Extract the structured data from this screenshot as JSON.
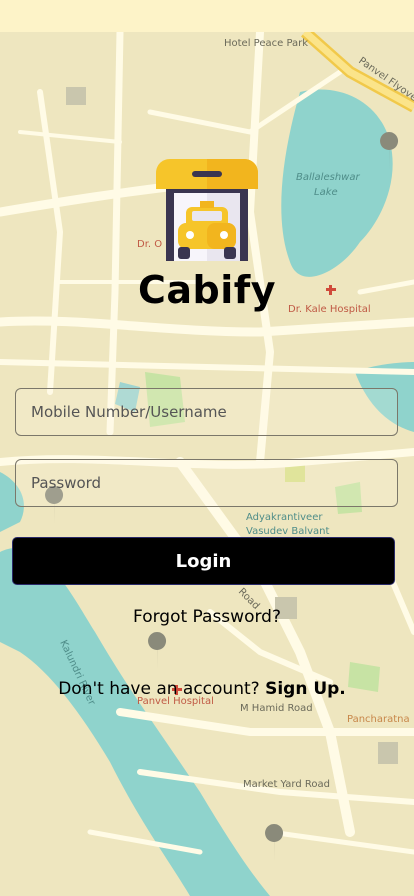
{
  "app": {
    "name": "Cabify"
  },
  "form": {
    "username_placeholder": "Mobile Number/Username",
    "password_placeholder": "Password",
    "login_label": "Login",
    "forgot_label": "Forgot Password?"
  },
  "signup": {
    "prompt": "Don't have an account?",
    "link_label": "Sign Up."
  },
  "map_labels": {
    "hotel": "Hotel Peace Park",
    "flyover": "Panvel Flyover",
    "lake": "Ballaleshwar",
    "lake2": "Lake",
    "hospital1": "Dr. Kale Hospital",
    "dr": "Dr. O",
    "adya": "Adyakrantiveer",
    "vasudev": "Vasudev Balvant",
    "panvel_hospital": "Panvel Hospital",
    "m_hamid": "M Hamid Road",
    "pancharatna": "Pancharatna",
    "market_yard": "Market Yard Road",
    "river": "Kalundri River",
    "road": "Road"
  },
  "colors": {
    "map_bg": "#eee6bf",
    "road": "#fffbe6",
    "water": "#8fd3cc",
    "park": "#c7e3a4",
    "button_bg": "#000000"
  }
}
